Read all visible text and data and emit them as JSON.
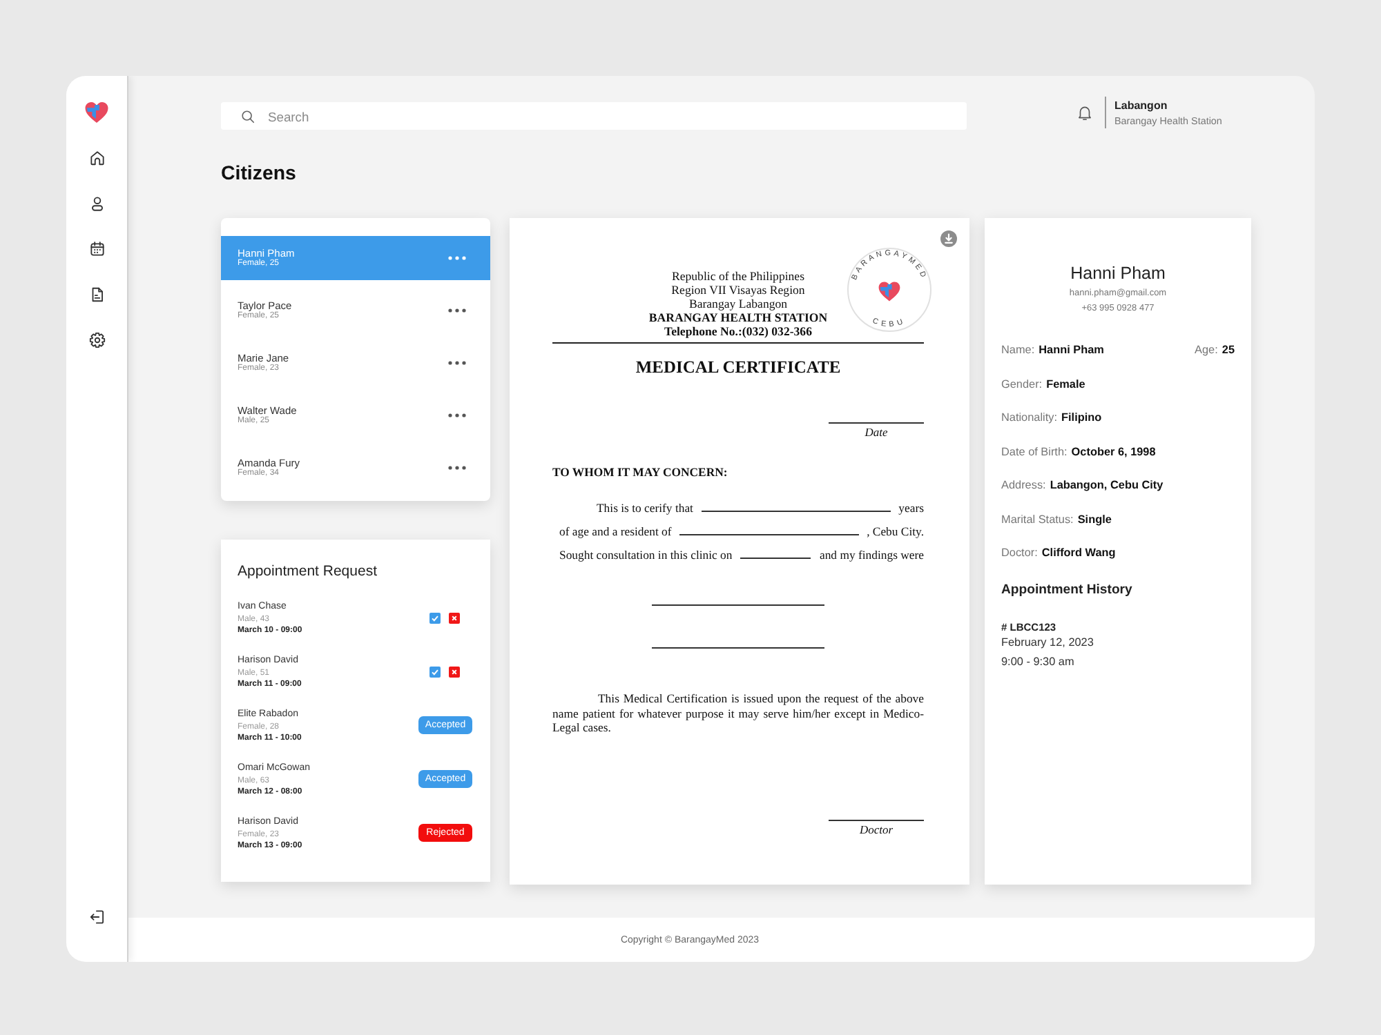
{
  "search": {
    "placeholder": "Search"
  },
  "account": {
    "name": "Labangon",
    "subtitle": "Barangay Health Station"
  },
  "page_title": "Citizens",
  "citizens": [
    {
      "name": "Hanni Pham",
      "details": "Female, 25",
      "selected": true
    },
    {
      "name": "Taylor Pace",
      "details": "Female, 25",
      "selected": false
    },
    {
      "name": "Marie Jane",
      "details": "Female, 23",
      "selected": false
    },
    {
      "name": "Walter Wade",
      "details": "Male, 25",
      "selected": false
    },
    {
      "name": "Amanda Fury",
      "details": "Female, 34",
      "selected": false
    }
  ],
  "appointment_requests": {
    "title": "Appointment Request",
    "items": [
      {
        "name": "Ivan Chase",
        "details": "Male, 43",
        "schedule": "March 10 - 09:00",
        "kind": "pending"
      },
      {
        "name": "Harison David",
        "details": "Male, 51",
        "schedule": "March 11 - 09:00",
        "kind": "pending"
      },
      {
        "name": "Elite Rabadon",
        "details": "Female, 28",
        "schedule": "March 11 - 10:00",
        "kind": "accepted",
        "badge": "Accepted"
      },
      {
        "name": "Omari McGowan",
        "details": "Male, 63",
        "schedule": "March 12 - 08:00",
        "kind": "accepted",
        "badge": "Accepted"
      },
      {
        "name": "Harison David",
        "details": "Female, 23",
        "schedule": "March 13 - 09:00",
        "kind": "rejected",
        "badge": "Rejected"
      }
    ]
  },
  "certificate": {
    "header_lines": [
      "Republic of the Philippines",
      "Region VII Visayas Region",
      "Barangay Labangon"
    ],
    "office_lines": [
      "BARANGAY HEALTH STATION",
      "Telephone No.:(032) 032-366"
    ],
    "seal": {
      "top_text": "BARANGAYMED",
      "bottom_text": "CEBU"
    },
    "title": "MEDICAL CERTIFICATE",
    "date_label": "Date",
    "salutation": "TO WHOM IT MAY CONCERN:",
    "body_lines": [
      {
        "before": "This is to cerify that",
        "after": "years"
      },
      {
        "before": "of age and a resident of",
        "after": ", Cebu City."
      },
      {
        "before": "Sought consultation in this clinic on",
        "after": "and my findings were"
      }
    ],
    "closing": "This Medical Certification is issued upon the request of the above name patient for whatever purpose it may serve him/her except in Medico-Legal cases.",
    "signature_label": "Doctor"
  },
  "profile": {
    "name": "Hanni Pham",
    "email": "hanni.pham@gmail.com",
    "phone": "+63 995 0928 477",
    "details": [
      {
        "label": "Name:",
        "value": "Hanni Pham",
        "aside": {
          "label": "Age:",
          "value": "25"
        }
      },
      {
        "label": "Gender:",
        "value": "Female"
      },
      {
        "label": "Nationality:",
        "value": "Filipino"
      },
      {
        "label": "Date of Birth:",
        "value": "October 6, 1998"
      },
      {
        "label": "Address:",
        "value": "Labangon, Cebu City"
      },
      {
        "label": "Marital Status:",
        "value": "Single"
      },
      {
        "label": "Doctor:",
        "value": "Clifford Wang"
      }
    ],
    "history": {
      "title": "Appointment History",
      "entries": [
        {
          "code": "# LBCC123",
          "date": "February 12, 2023",
          "time": "9:00 - 9:30 am"
        }
      ]
    }
  },
  "footer": "Copyright © BarangayMed 2023"
}
